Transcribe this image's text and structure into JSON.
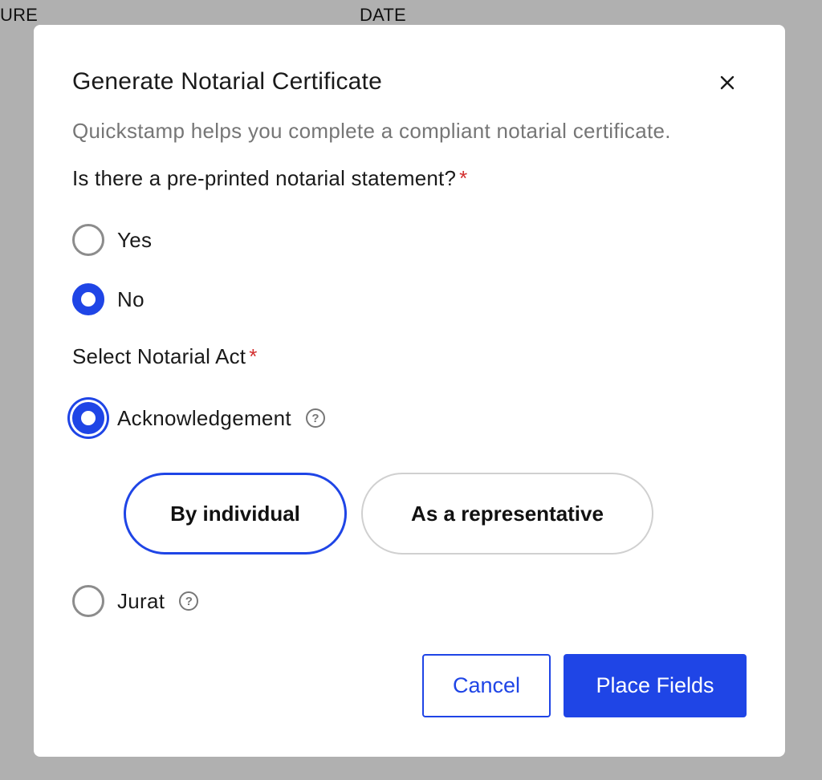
{
  "background": {
    "signature_label": "URE",
    "date_label": "DATE"
  },
  "modal": {
    "title": "Generate Notarial Certificate",
    "subtitle": "Quickstamp helps you complete a compliant notarial certificate.",
    "close_icon": "close-icon"
  },
  "preprinted_question": {
    "label": "Is there a pre-printed notarial statement?",
    "required_mark": "*",
    "options": [
      {
        "label": "Yes",
        "checked": false
      },
      {
        "label": "No",
        "checked": true
      }
    ]
  },
  "notarial_act": {
    "label": "Select Notarial Act",
    "required_mark": "*",
    "options": [
      {
        "label": "Acknowledgement",
        "checked": true,
        "help_icon": "question-circle-icon"
      },
      {
        "label": "Jurat",
        "checked": false,
        "help_icon": "question-circle-icon"
      }
    ],
    "acknowledgement_types": [
      {
        "label": "By individual",
        "selected": true
      },
      {
        "label": "As a representative",
        "selected": false
      }
    ]
  },
  "footer": {
    "cancel_label": "Cancel",
    "place_fields_label": "Place Fields"
  },
  "colors": {
    "accent": "#1f45e6",
    "required": "#d32f2f",
    "overlay": "#b0b0b0"
  }
}
